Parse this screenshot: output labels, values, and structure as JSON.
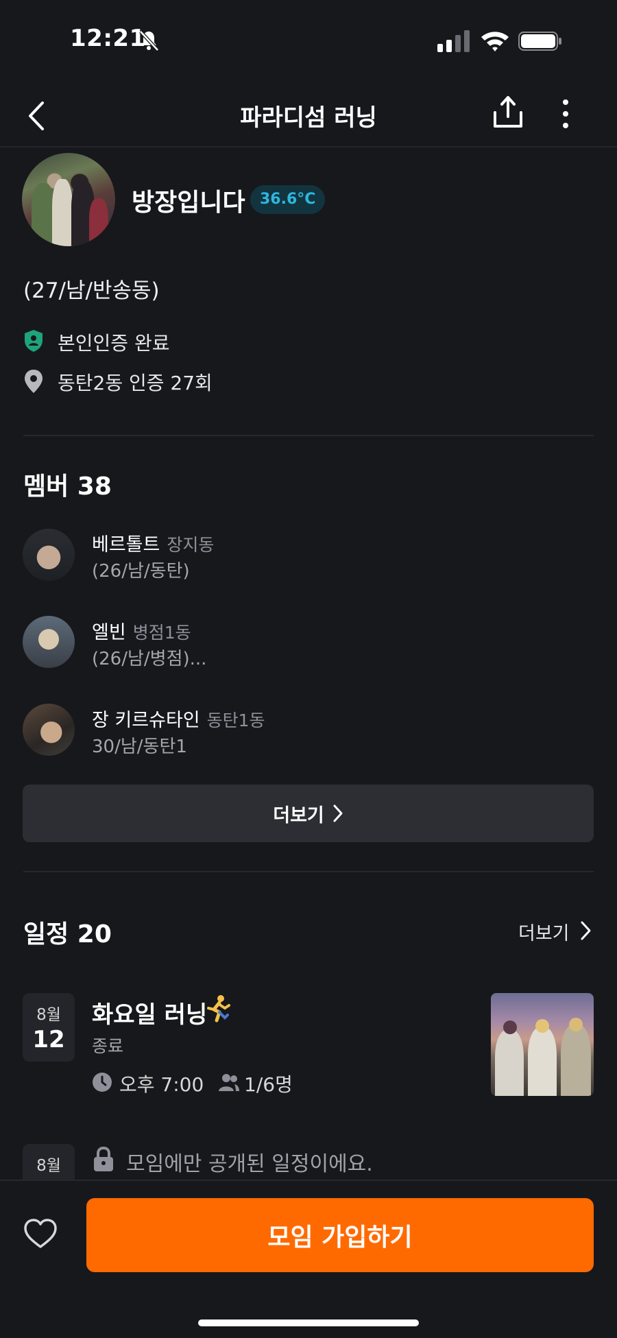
{
  "status_bar": {
    "time": "12:21"
  },
  "header": {
    "title": "파라디섬 러닝"
  },
  "host": {
    "name": "방장입니다",
    "temperature": "36.6°C",
    "info": "(27/남/반송동)",
    "verification": "본인인증 완료",
    "location_auth": "동탄2동 인증 27회"
  },
  "members": {
    "title": "멤버 38",
    "items": [
      {
        "name": "베르톨트",
        "location": "장지동",
        "desc": "(26/남/동탄)"
      },
      {
        "name": "엘빈",
        "location": "병점1동",
        "desc": "(26/남/병점)..."
      },
      {
        "name": "장 키르슈타인",
        "location": "동탄1동",
        "desc": "30/남/동탄1"
      }
    ],
    "more_label": "더보기"
  },
  "schedule": {
    "title": "일정 20",
    "more_label": "더보기",
    "events": [
      {
        "month": "8월",
        "day": "12",
        "title": "화요일 러닝",
        "status": "종료",
        "time": "오후 7:00",
        "count": "1/6명"
      }
    ],
    "private_event": {
      "month": "8월",
      "message": "모임에만 공개된 일정이에요."
    }
  },
  "bottom": {
    "join_label": "모임 가입하기"
  },
  "colors": {
    "accent": "#ff6a00",
    "temp_text": "#2fb6df",
    "background": "#17181c"
  }
}
